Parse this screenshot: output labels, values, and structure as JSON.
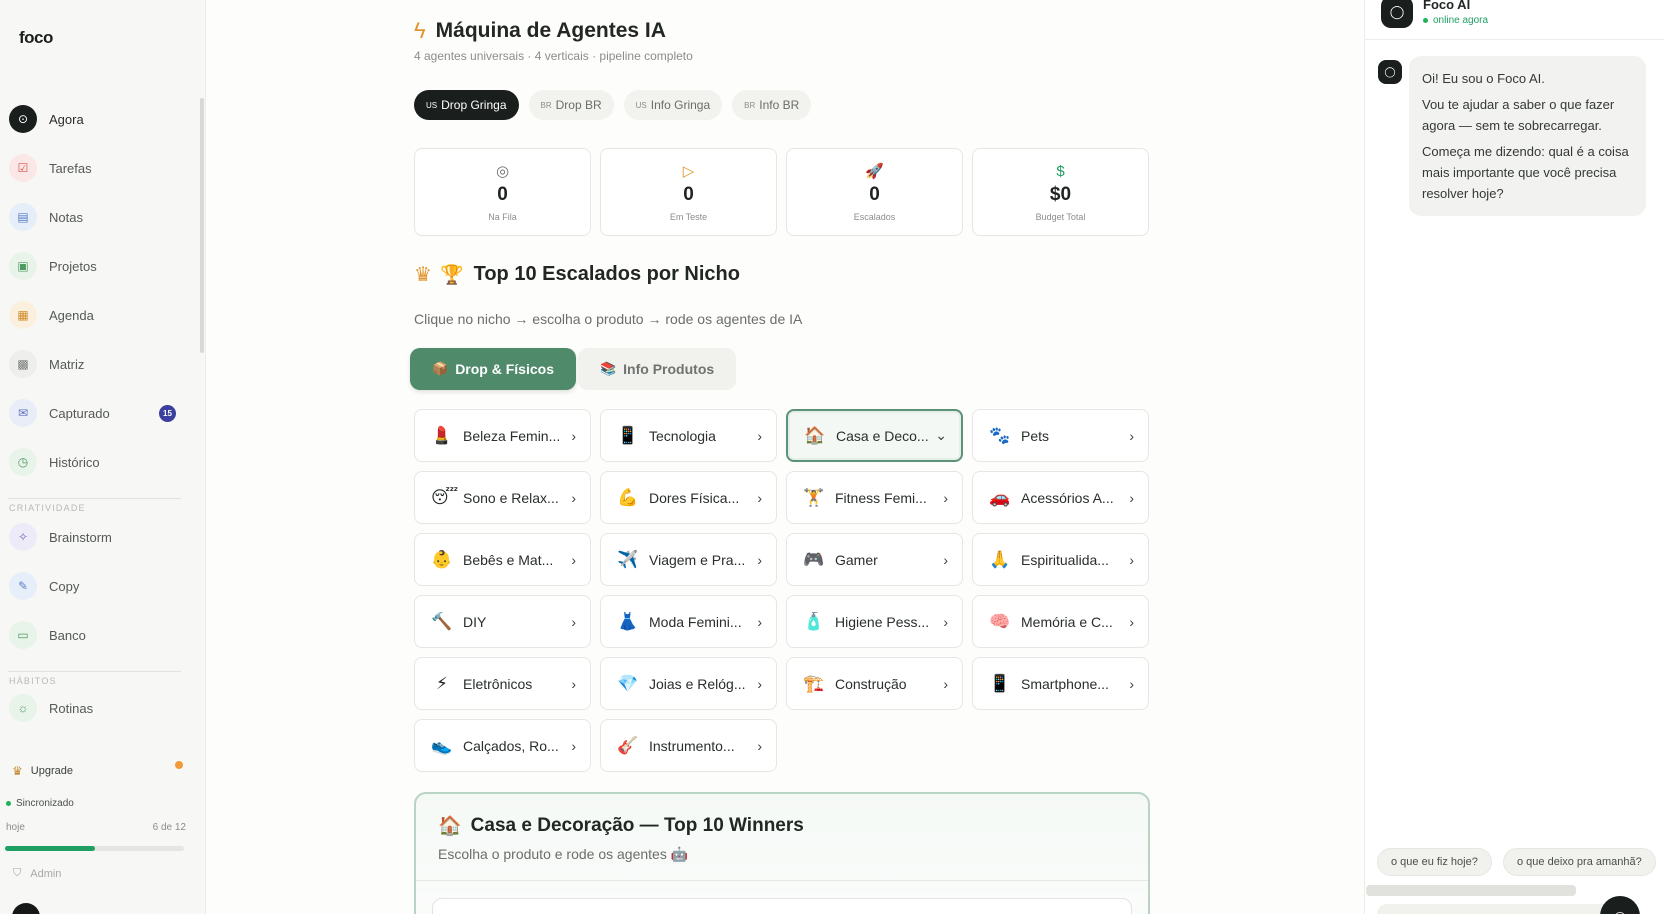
{
  "sidebar": {
    "logo": "foco",
    "items": [
      {
        "label": "Agora",
        "icon": "⊙",
        "bg": "#1a1e1c",
        "fg": "#ffffff"
      },
      {
        "label": "Tarefas",
        "icon": "☑",
        "bg": "#fbe7e5",
        "fg": "#d9534f"
      },
      {
        "label": "Notas",
        "icon": "▤",
        "bg": "#e6eef9",
        "fg": "#5b7fc7"
      },
      {
        "label": "Projetos",
        "icon": "▣",
        "bg": "#e8f3ea",
        "fg": "#4f9a63"
      },
      {
        "label": "Agenda",
        "icon": "▦",
        "bg": "#fbf0de",
        "fg": "#d18a2b"
      },
      {
        "label": "Matriz",
        "icon": "▩",
        "bg": "#eeeeec",
        "fg": "#777b78"
      },
      {
        "label": "Capturado",
        "icon": "✉",
        "bg": "#e9edf8",
        "fg": "#5f6fbf",
        "badge": "15"
      },
      {
        "label": "Histórico",
        "icon": "◷",
        "bg": "#e8f3ea",
        "fg": "#4f9a63"
      }
    ],
    "section_criatividade": "CRIATIVIDADE",
    "criatividade_items": [
      {
        "label": "Brainstorm",
        "icon": "✧",
        "bg": "#eeebf8",
        "fg": "#7a68c4"
      },
      {
        "label": "Copy",
        "icon": "✎",
        "bg": "#e6eef9",
        "fg": "#5b7fc7"
      },
      {
        "label": "Banco",
        "icon": "▭",
        "bg": "#e8f3ea",
        "fg": "#4f9a63"
      }
    ],
    "section_habitos": "HÁBITOS",
    "habitos_items": [
      {
        "label": "Rotinas",
        "icon": "☼",
        "bg": "#e8f3ea",
        "fg": "#4f9a63"
      }
    ],
    "upgrade_label": "Upgrade",
    "sync_label": "Sincronizado",
    "progress_left": "hoje",
    "progress_right": "6 de 12",
    "progress_fraction": 0.5,
    "admin_label": "Admin"
  },
  "main": {
    "title": "Máquina de Agentes IA",
    "subtitle": "4 agentes universais · 4 verticais · pipeline completo",
    "market_tabs": [
      {
        "flag": "US",
        "label": "Drop Gringa",
        "active": true
      },
      {
        "flag": "BR",
        "label": "Drop BR",
        "active": false
      },
      {
        "flag": "US",
        "label": "Info Gringa",
        "active": false
      },
      {
        "flag": "BR",
        "label": "Info BR",
        "active": false
      }
    ],
    "stats": [
      {
        "icon": "◎",
        "icon_color": "#6a6f6b",
        "value": "0",
        "label": "Na Fila"
      },
      {
        "icon": "▷",
        "icon_color": "#e0952c",
        "value": "0",
        "label": "Em Teste"
      },
      {
        "icon": "🚀",
        "icon_color": "#1f9f62",
        "value": "0",
        "label": "Escalados"
      },
      {
        "icon": "$",
        "icon_color": "#1f9f62",
        "value": "$0",
        "label": "Budget Total"
      }
    ],
    "section_title": "Top 10 Escalados por Nicho",
    "section_subtitle": "Clique no nicho → escolha o produto → rode os agentes de IA",
    "category_tabs": [
      {
        "emoji": "📦",
        "label": "Drop & Físicos",
        "active": true
      },
      {
        "emoji": "📚",
        "label": "Info Produtos",
        "active": false
      }
    ],
    "niches": [
      {
        "emoji": "💄",
        "label": "Beleza Femin...",
        "selected": false
      },
      {
        "emoji": "📱",
        "label": "Tecnologia",
        "selected": false
      },
      {
        "emoji": "🏠",
        "label": "Casa e Deco...",
        "selected": true
      },
      {
        "emoji": "🐾",
        "label": "Pets",
        "selected": false
      },
      {
        "emoji": "😴",
        "label": "Sono e Relax...",
        "selected": false
      },
      {
        "emoji": "💪",
        "label": "Dores Física...",
        "selected": false
      },
      {
        "emoji": "🏋️",
        "label": "Fitness Femi...",
        "selected": false
      },
      {
        "emoji": "🚗",
        "label": "Acessórios A...",
        "selected": false
      },
      {
        "emoji": "👶",
        "label": "Bebês e Mat...",
        "selected": false
      },
      {
        "emoji": "✈️",
        "label": "Viagem e Pra...",
        "selected": false
      },
      {
        "emoji": "🎮",
        "label": "Gamer",
        "selected": false
      },
      {
        "emoji": "🙏",
        "label": "Espiritualida...",
        "selected": false
      },
      {
        "emoji": "🔨",
        "label": "DIY",
        "selected": false
      },
      {
        "emoji": "👗",
        "label": "Moda Femini...",
        "selected": false
      },
      {
        "emoji": "🧴",
        "label": "Higiene Pess...",
        "selected": false
      },
      {
        "emoji": "🧠",
        "label": "Memória e C...",
        "selected": false
      },
      {
        "emoji": "⚡",
        "label": "Eletrônicos",
        "selected": false
      },
      {
        "emoji": "💎",
        "label": "Joias e Relóg...",
        "selected": false
      },
      {
        "emoji": "🏗️",
        "label": "Construção",
        "selected": false
      },
      {
        "emoji": "📱",
        "label": "Smartphone...",
        "selected": false
      },
      {
        "emoji": "👟",
        "label": "Calçados, Ro...",
        "selected": false
      },
      {
        "emoji": "🎸",
        "label": "Instrumento...",
        "selected": false
      }
    ],
    "winners": {
      "emoji": "🏠",
      "title": "Casa e Decoração — Top 10 Winners",
      "subtitle": "Escolha o produto e rode os agentes 🤖"
    }
  },
  "chat": {
    "name": "Foco AI",
    "status": "online agora",
    "message": [
      "Oi! Eu sou o Foco AI.",
      "Vou te ajudar a saber o que fazer agora — sem te sobrecarregar.",
      "Começa me dizendo: qual é a coisa mais importante que você precisa resolver hoje?"
    ],
    "quick_replies": [
      "o que eu fiz hoje?",
      "o que deixo pra amanhã?"
    ]
  },
  "colors": {
    "accent": "#4f8a6a",
    "dark": "#1a1e1c",
    "badge": "#3b3f9e",
    "online": "#1fb25a"
  }
}
